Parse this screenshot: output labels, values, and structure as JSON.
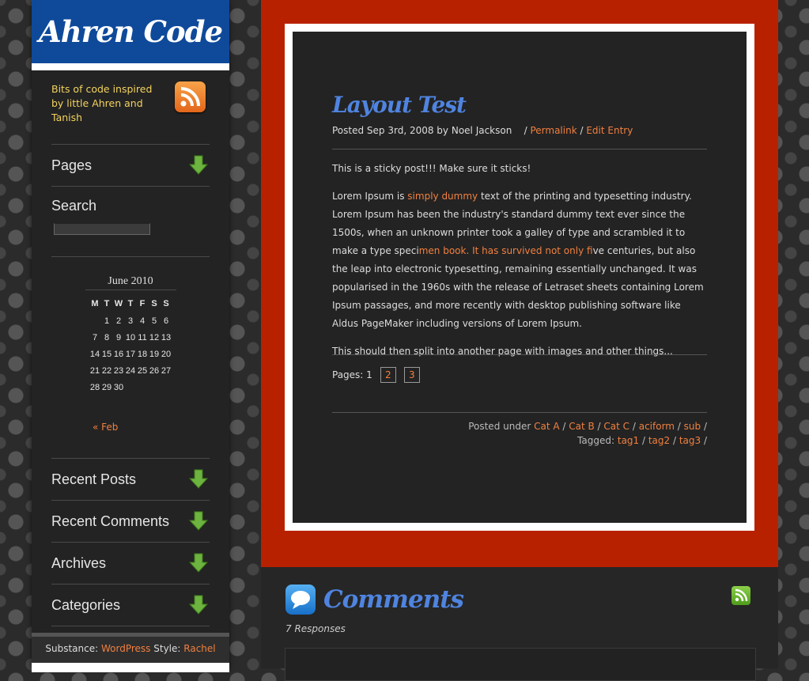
{
  "site": {
    "title": "Ahren Code",
    "tagline": "Bits of code inspired by little Ahren and Tanish"
  },
  "sidebar": {
    "pages_label": "Pages",
    "search_label": "Search",
    "search_value": "",
    "recent_posts_label": "Recent Posts",
    "recent_comments_label": "Recent Comments",
    "archives_label": "Archives",
    "categories_label": "Categories"
  },
  "calendar": {
    "caption": "June 2010",
    "weekdays": [
      "M",
      "T",
      "W",
      "T",
      "F",
      "S",
      "S"
    ],
    "weeks": [
      [
        "",
        "1",
        "2",
        "3",
        "4",
        "5",
        "6"
      ],
      [
        "7",
        "8",
        "9",
        "10",
        "11",
        "12",
        "13"
      ],
      [
        "14",
        "15",
        "16",
        "17",
        "18",
        "19",
        "20"
      ],
      [
        "21",
        "22",
        "23",
        "24",
        "25",
        "26",
        "27"
      ],
      [
        "28",
        "29",
        "30",
        "",
        "",
        "",
        ""
      ]
    ],
    "prev_link": "« Feb"
  },
  "footer": {
    "substance_label": "Substance:",
    "substance_link": "WordPress",
    "style_label": "Style:",
    "style_link": "Rachel"
  },
  "post": {
    "title": "Layout Test",
    "meta_prefix": "Posted Sep 3rd, 2008 by Noel Jackson",
    "permalink": "Permalink",
    "edit_entry": "Edit Entry",
    "p1": "This is a sticky post!!! Make sure it sticks!",
    "p2_a": "Lorem Ipsum is ",
    "p2_link1": "simply dummy",
    "p2_b": " text of the printing and typesetting industry. Lorem Ipsum has been the industry's standard dummy text ever since the 1500s, when an unknown printer took a galley of type and scrambled it to make a type speci",
    "p2_link2": "men book. It has survived not only fi",
    "p2_c": "ve centuries, but also the leap into electronic typesetting, remaining essentially unchanged. It was popularised in the 1960s with the release of Letraset sheets containing Lorem Ipsum passages, and more recently with desktop publishing software like Aldus PageMaker including versions of Lorem Ipsum.",
    "p3": "This should then split into another page with images and other things...",
    "pages_label": "Pages: 1",
    "page2": "2",
    "page3": "3",
    "posted_under": "Posted under",
    "categories": [
      "Cat A",
      "Cat B",
      "Cat C",
      "aciform",
      "sub"
    ],
    "tagged": "Tagged:",
    "tags": [
      "tag1",
      "tag2",
      "tag3"
    ]
  },
  "comments": {
    "title": "Comments",
    "count": "7 Responses"
  },
  "icons": {
    "rss": "rss-icon",
    "arrow": "down-arrow-icon",
    "comment": "speech-bubble-icon"
  },
  "colors": {
    "header_blue": "#0f4a9a",
    "main_red": "#b82100",
    "link_orange": "#f08040",
    "title_blue": "#4f84e0",
    "tagline_yellow": "#f4d35e"
  }
}
